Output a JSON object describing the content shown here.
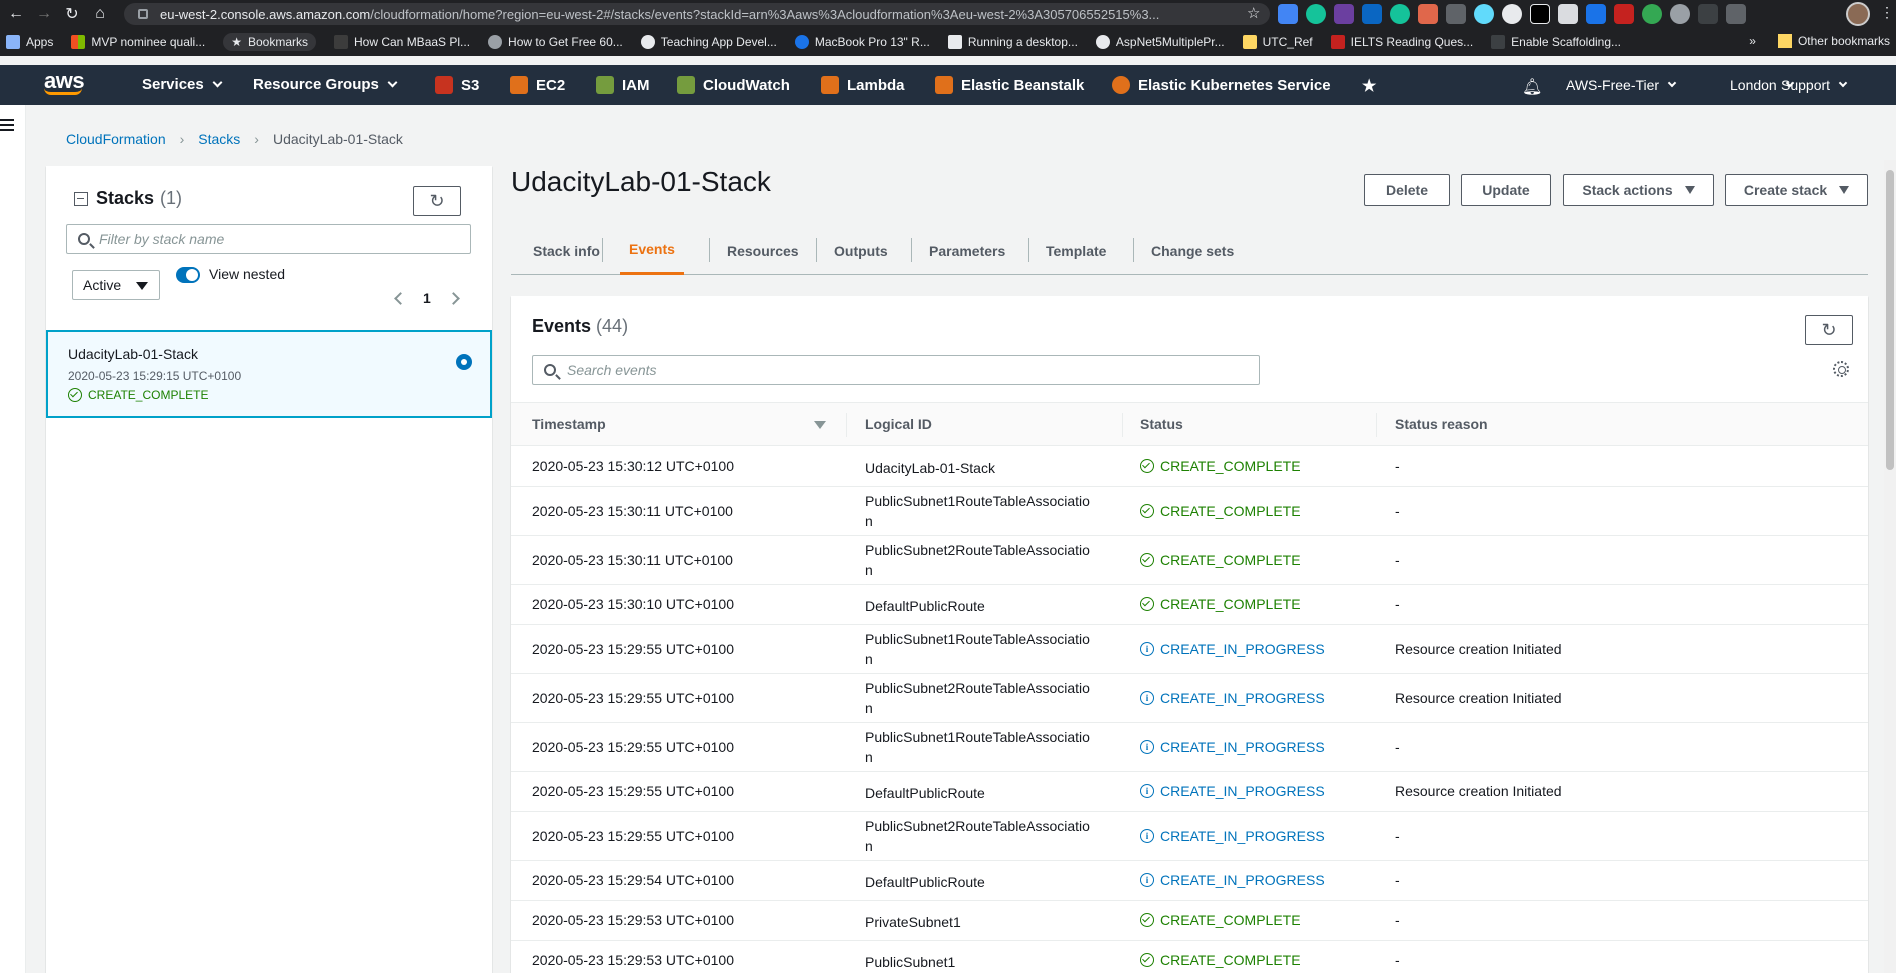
{
  "browser": {
    "url_host": "eu-west-2.console.aws.amazon.com",
    "url_path": "/cloudformation/home?region=eu-west-2#/stacks/events?stackId=arn%3Aaws%3Acloudformation%3Aeu-west-2%3A305706552515%3..."
  },
  "bookmarks": {
    "items": [
      "Apps",
      "MVP nominee quali...",
      "Bookmarks",
      "How Can MBaaS Pl...",
      "How to Get Free 60...",
      "Teaching App Devel...",
      "MacBook Pro 13\" R...",
      "Running a desktop...",
      "AspNet5MultiplePr...",
      "UTC_Ref",
      "IELTS Reading Ques...",
      "Enable Scaffolding..."
    ],
    "overflow": "»",
    "other": "Other bookmarks"
  },
  "aws_nav": {
    "logo": "aws",
    "services": "Services",
    "resource_groups": "Resource Groups",
    "shortcuts": [
      "S3",
      "EC2",
      "IAM",
      "CloudWatch",
      "Lambda",
      "Elastic Beanstalk",
      "Elastic Kubernetes Service"
    ],
    "account": "AWS-Free-Tier",
    "region": "London",
    "support": "Support"
  },
  "breadcrumb": [
    "CloudFormation",
    "Stacks",
    "UdacityLab-01-Stack"
  ],
  "stacks_panel": {
    "title": "Stacks",
    "count": "(1)",
    "filter_placeholder": "Filter by stack name",
    "status_filter": "Active",
    "view_nested": "View nested",
    "page": "1",
    "stack": {
      "name": "UdacityLab-01-Stack",
      "timestamp": "2020-05-23 15:29:15 UTC+0100",
      "status": "CREATE_COMPLETE"
    }
  },
  "main": {
    "title": "UdacityLab-01-Stack",
    "buttons": {
      "delete": "Delete",
      "update": "Update",
      "stack_actions": "Stack actions",
      "create_stack": "Create stack"
    },
    "tabs": [
      "Stack info",
      "Events",
      "Resources",
      "Outputs",
      "Parameters",
      "Template",
      "Change sets"
    ],
    "active_tab": "Events"
  },
  "events": {
    "title": "Events",
    "count": "(44)",
    "search_placeholder": "Search events",
    "columns": [
      "Timestamp",
      "Logical ID",
      "Status",
      "Status reason"
    ],
    "rows": [
      {
        "ts": "2020-05-23 15:30:12 UTC+0100",
        "id": "UdacityLab-01-Stack",
        "status": "CREATE_COMPLETE",
        "reason": "-"
      },
      {
        "ts": "2020-05-23 15:30:11 UTC+0100",
        "id": "PublicSubnet1RouteTableAssociation",
        "status": "CREATE_COMPLETE",
        "reason": "-"
      },
      {
        "ts": "2020-05-23 15:30:11 UTC+0100",
        "id": "PublicSubnet2RouteTableAssociation",
        "status": "CREATE_COMPLETE",
        "reason": "-"
      },
      {
        "ts": "2020-05-23 15:30:10 UTC+0100",
        "id": "DefaultPublicRoute",
        "status": "CREATE_COMPLETE",
        "reason": "-"
      },
      {
        "ts": "2020-05-23 15:29:55 UTC+0100",
        "id": "PublicSubnet1RouteTableAssociation",
        "status": "CREATE_IN_PROGRESS",
        "reason": "Resource creation Initiated"
      },
      {
        "ts": "2020-05-23 15:29:55 UTC+0100",
        "id": "PublicSubnet2RouteTableAssociation",
        "status": "CREATE_IN_PROGRESS",
        "reason": "Resource creation Initiated"
      },
      {
        "ts": "2020-05-23 15:29:55 UTC+0100",
        "id": "PublicSubnet1RouteTableAssociation",
        "status": "CREATE_IN_PROGRESS",
        "reason": "-"
      },
      {
        "ts": "2020-05-23 15:29:55 UTC+0100",
        "id": "DefaultPublicRoute",
        "status": "CREATE_IN_PROGRESS",
        "reason": "Resource creation Initiated"
      },
      {
        "ts": "2020-05-23 15:29:55 UTC+0100",
        "id": "PublicSubnet2RouteTableAssociation",
        "status": "CREATE_IN_PROGRESS",
        "reason": "-"
      },
      {
        "ts": "2020-05-23 15:29:54 UTC+0100",
        "id": "DefaultPublicRoute",
        "status": "CREATE_IN_PROGRESS",
        "reason": "-"
      },
      {
        "ts": "2020-05-23 15:29:53 UTC+0100",
        "id": "PrivateSubnet1",
        "status": "CREATE_COMPLETE",
        "reason": "-"
      },
      {
        "ts": "2020-05-23 15:29:53 UTC+0100",
        "id": "PublicSubnet1",
        "status": "CREATE_COMPLETE",
        "reason": "-"
      }
    ]
  },
  "colors": {
    "aws_nav_bg": "#232f3e",
    "accent_orange": "#ec7211",
    "link_blue": "#0073bb",
    "success_green": "#1d8102"
  }
}
